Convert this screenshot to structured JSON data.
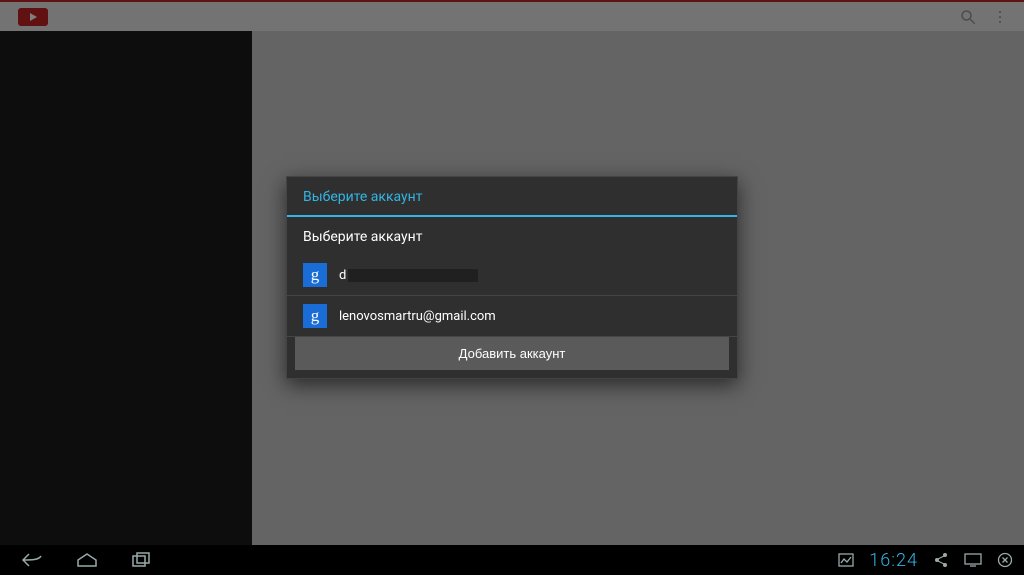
{
  "dialog": {
    "title": "Выберите аккаунт",
    "subtitle": "Выберите аккаунт",
    "accounts": [
      {
        "prefix": "d",
        "redacted": true
      },
      {
        "email": "lenovosmartru@gmail.com"
      }
    ],
    "add_button": "Добавить аккаунт"
  },
  "navbar": {
    "clock": "16:24"
  },
  "icons": {
    "google_letter": "g"
  }
}
